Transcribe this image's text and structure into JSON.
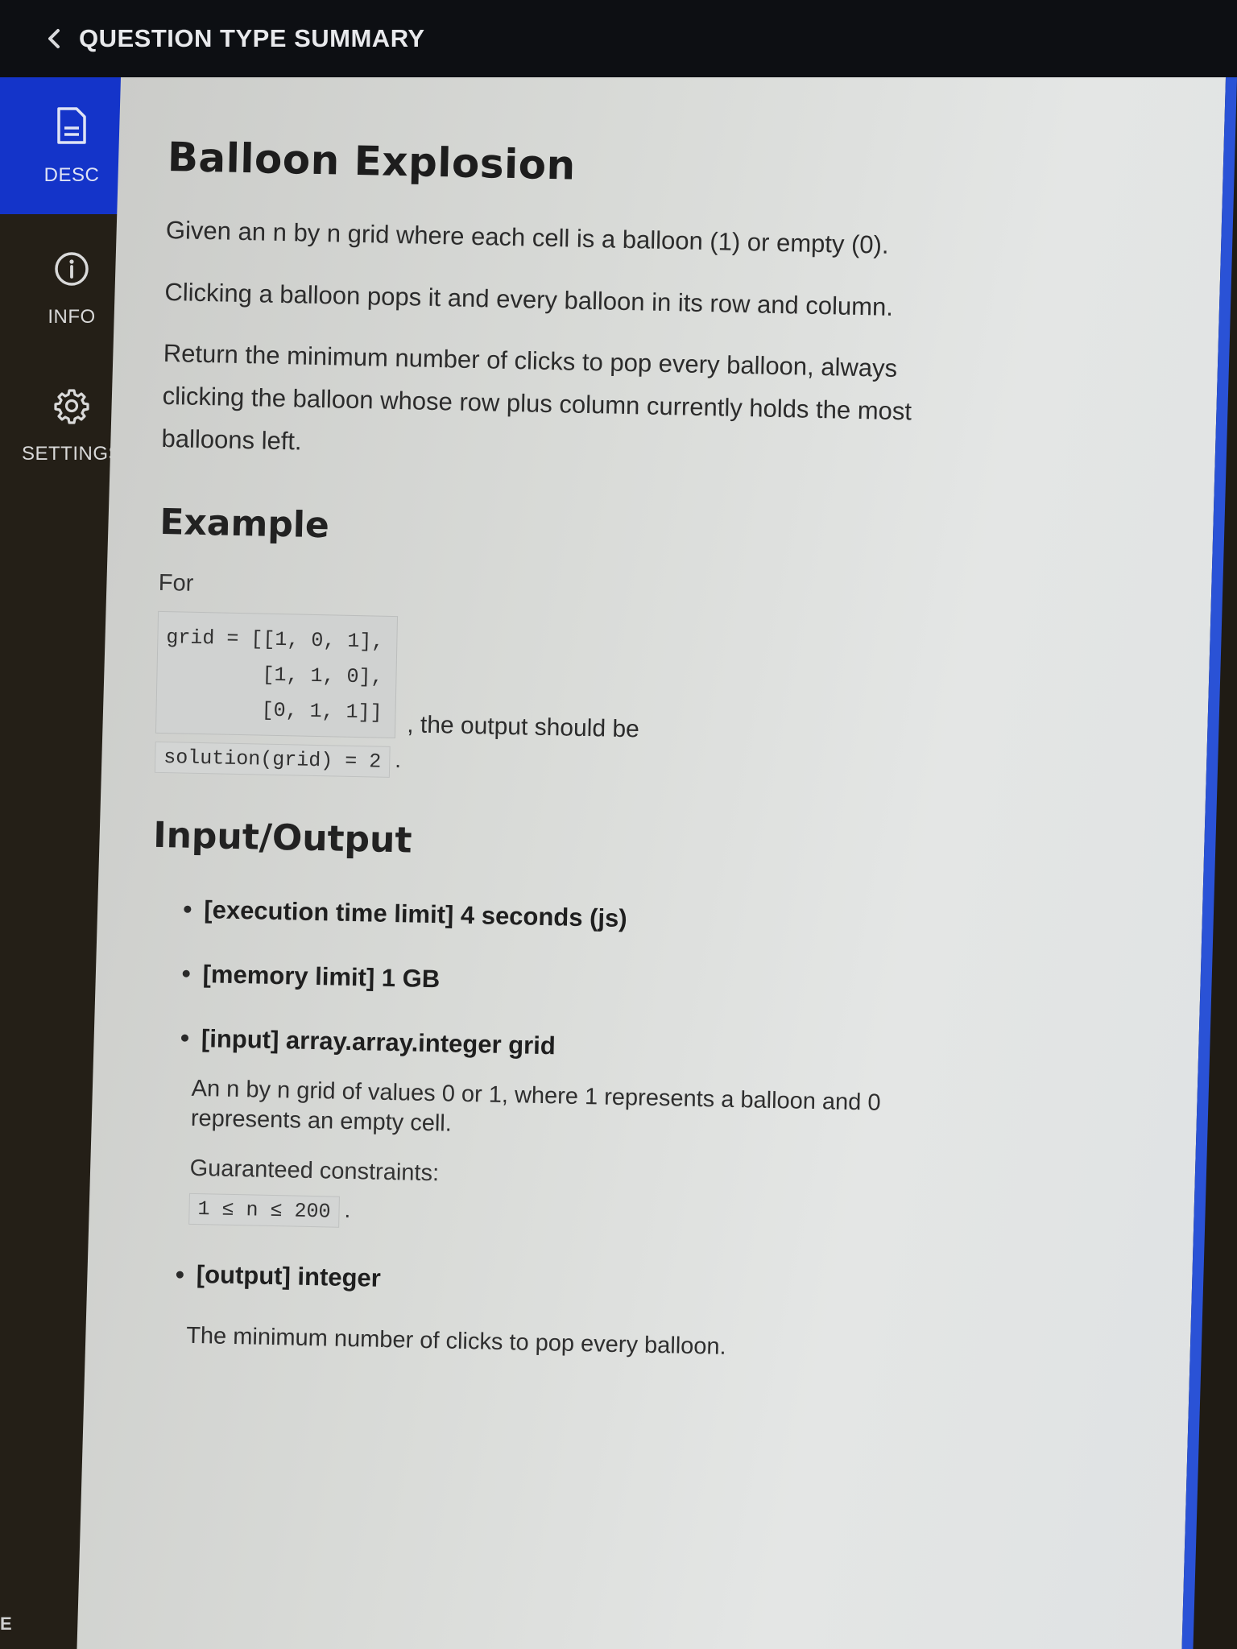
{
  "header": {
    "title": "QUESTION TYPE SUMMARY"
  },
  "sidebar": {
    "items": [
      {
        "label": "DESC",
        "icon": "document-icon",
        "active": true
      },
      {
        "label": "INFO",
        "icon": "info-icon",
        "active": false
      },
      {
        "label": "SETTINGS",
        "icon": "gear-icon",
        "active": false
      }
    ],
    "bottom_text": "E"
  },
  "colors": {
    "topbar": "#0d0f13",
    "sidebar": "#241f17",
    "active_nav": "#1434c9",
    "accent_edge": "#2a52d6"
  },
  "problem": {
    "title": "Balloon Explosion",
    "paragraphs": [
      "Given an n by n grid where each cell is a balloon (1) or empty (0).",
      "Clicking a balloon pops it and every balloon in its row and column.",
      "Return the minimum number of clicks to pop every balloon, always clicking the balloon whose row plus column currently holds the most balloons left."
    ]
  },
  "example": {
    "heading": "Example",
    "for_label": "For",
    "code": "grid = [[1, 0, 1],\n        [1, 1, 0],\n        [0, 1, 1]]",
    "after_code": ", the output should be",
    "solution_code": "solution(grid) = 2",
    "period": "."
  },
  "io": {
    "heading": "Input/Output",
    "time_limit": "[execution time limit] 4 seconds (js)",
    "memory_limit": "[memory limit] 1 GB",
    "input_label": "[input] array.array.integer grid",
    "input_desc": "An n by n grid of values 0 or 1, where 1 represents a balloon and 0 represents an empty cell.",
    "constraints_label": "Guaranteed constraints:",
    "constraint_code": "1 ≤ n ≤ 200",
    "constraint_period": ".",
    "output_label": "[output] integer",
    "output_desc": "The minimum number of clicks to pop every balloon."
  }
}
